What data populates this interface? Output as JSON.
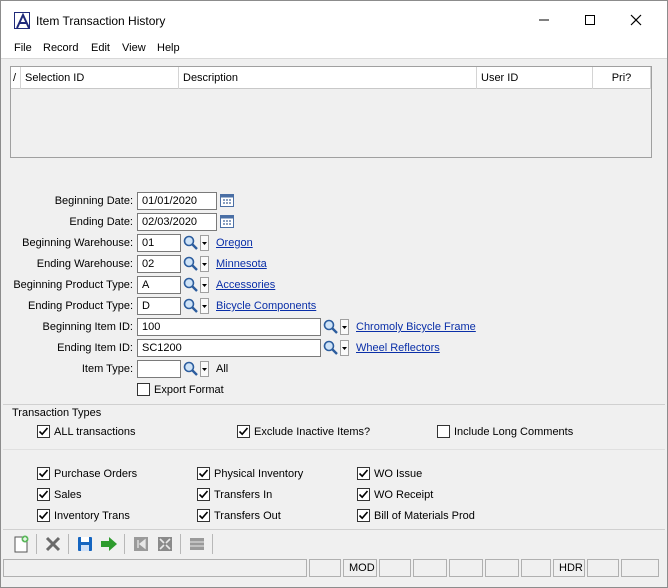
{
  "window": {
    "title": "Item Transaction History"
  },
  "menu": [
    "File",
    "Record",
    "Edit",
    "View",
    "Help"
  ],
  "grid": {
    "sort_marker": "/",
    "columns": [
      "Selection ID",
      "Description",
      "User ID",
      "Pri?"
    ]
  },
  "form": {
    "beginning_date": {
      "label": "Beginning Date:",
      "value": "01/01/2020"
    },
    "ending_date": {
      "label": "Ending Date:",
      "value": "02/03/2020"
    },
    "beginning_warehouse": {
      "label": "Beginning Warehouse:",
      "value": "01",
      "link": "Oregon"
    },
    "ending_warehouse": {
      "label": "Ending Warehouse:",
      "value": "02",
      "link": "Minnesota"
    },
    "beginning_product_type": {
      "label": "Beginning Product Type:",
      "value": "A",
      "link": "Accessories"
    },
    "ending_product_type": {
      "label": "Ending Product Type:",
      "value": "D",
      "link": "Bicycle Components"
    },
    "beginning_item_id": {
      "label": "Beginning Item ID:",
      "value": "100",
      "link": "Chromoly Bicycle Frame"
    },
    "ending_item_id": {
      "label": "Ending Item ID:",
      "value": "SC1200",
      "link": "Wheel Reflectors"
    },
    "item_type": {
      "label": "Item Type:",
      "value": "",
      "text": "All"
    },
    "export_format": {
      "label": "Export Format",
      "checked": false
    }
  },
  "transaction_types": {
    "heading": "Transaction Types",
    "all_transactions": {
      "label": "ALL transactions",
      "checked": true
    },
    "exclude_inactive": {
      "label": "Exclude Inactive Items?",
      "checked": true
    },
    "include_long_comments": {
      "label": "Include Long Comments",
      "checked": false
    },
    "purchase_orders": {
      "label": "Purchase Orders",
      "checked": true
    },
    "sales": {
      "label": "Sales",
      "checked": true
    },
    "inventory_trans": {
      "label": "Inventory Trans",
      "checked": true
    },
    "physical_inventory": {
      "label": "Physical Inventory",
      "checked": true
    },
    "transfers_in": {
      "label": "Transfers In",
      "checked": true
    },
    "transfers_out": {
      "label": "Transfers Out",
      "checked": true
    },
    "wo_issue": {
      "label": "WO Issue",
      "checked": true
    },
    "wo_receipt": {
      "label": "WO Receipt",
      "checked": true
    },
    "bill_of_materials_prod": {
      "label": "Bill of Materials Prod",
      "checked": true
    }
  },
  "toolbar": {
    "icons": [
      "new-record-icon",
      "delete-icon",
      "save-icon",
      "run-arrow-icon",
      "first-record-icon",
      "collapse-icon",
      "grid-icon"
    ]
  },
  "statusbar": {
    "mod": "MOD",
    "hdr": "HDR"
  },
  "colors": {
    "link": "#0a2fa8",
    "window_bg": "#f0f0f0",
    "accent_blue": "#1f2a7a",
    "save_blue": "#1565c0",
    "arrow_green": "#2e9b2e",
    "delete_gray": "#6a6a6a"
  }
}
